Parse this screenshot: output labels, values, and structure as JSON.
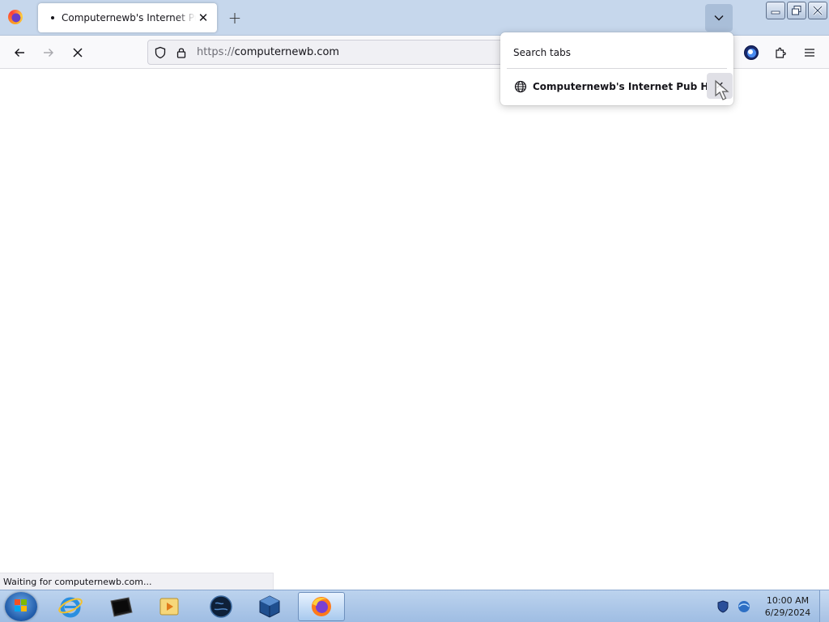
{
  "browser": {
    "tab": {
      "title": "Computernewb's Internet Pub Hub!",
      "close_glyph": "✕"
    },
    "new_tab_glyph": "+",
    "url": {
      "scheme": "https://",
      "host": "computernewb.com"
    },
    "status_text": "Waiting for computernewb.com..."
  },
  "tab_search_popup": {
    "search_label": "Search tabs",
    "items": [
      {
        "label": "Computernewb's Internet Pub Hub!",
        "close_glyph": "✕"
      }
    ]
  },
  "taskbar": {
    "apps": [
      "internet-explorer",
      "terminal",
      "media-player",
      "network-globe",
      "virtualbox",
      "firefox"
    ],
    "clock": {
      "time": "10:00 AM",
      "date": "6/29/2024"
    }
  }
}
